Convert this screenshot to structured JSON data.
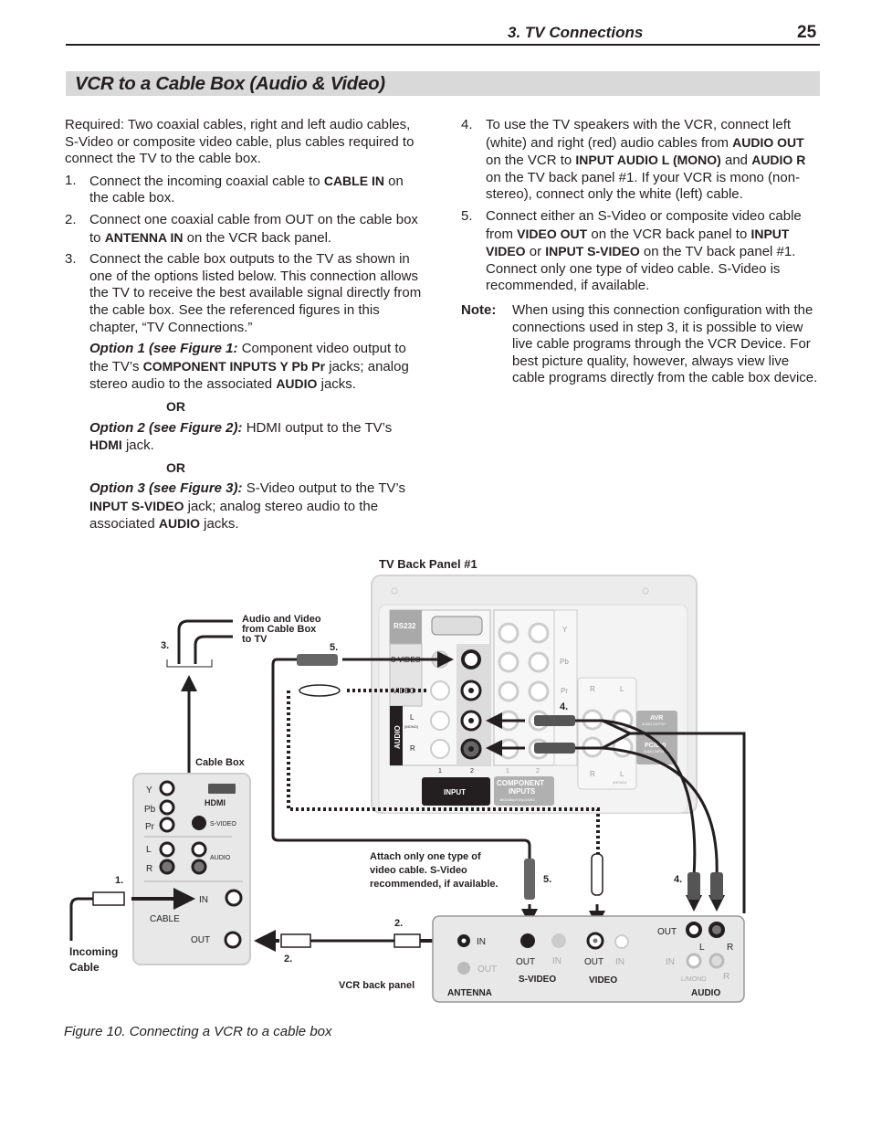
{
  "header": {
    "section": "3. TV Connections",
    "page_number": "25"
  },
  "title": "VCR to a Cable Box (Audio & Video)",
  "left": {
    "required": "Required:  Two coaxial cables, right and left audio cables, S-Video or composite video cable, plus cables required to connect the TV to the cable box.",
    "steps": [
      {
        "n": "1.",
        "a": "Connect the incoming coaxial cable to ",
        "b": "CABLE IN",
        "c": " on the cable box."
      },
      {
        "n": "2.",
        "a": "Connect one coaxial cable from OUT on the cable box to ",
        "b": "ANTENNA IN",
        "c": " on the VCR back panel."
      },
      {
        "n": "3.",
        "a": "Connect the cable box outputs to the TV as shown in one of the options listed below.  This connection allows the TV to receive the best available signal directly from the cable box.  See the referenced figures in this chapter, “TV Connections.”"
      }
    ],
    "option1": {
      "label": "Option 1 (see Figure 1:",
      "a": " Component video output to the TV’s ",
      "b": "COMPONENT INPUTS  Y Pb Pr",
      "c": " jacks; analog stereo audio to the associated ",
      "d": "AUDIO",
      "e": " jacks."
    },
    "or": "OR",
    "option2": {
      "label": "Option 2 (see Figure 2):",
      "a": " HDMI output to the TV’s ",
      "b": "HDMI",
      "c": " jack."
    },
    "option3": {
      "label": "Option 3 (see Figure 3):",
      "a": " S-Video output to the TV’s ",
      "b": "INPUT S-VIDEO",
      "c": " jack; analog stereo audio to the associated ",
      "d": "AUDIO",
      "e": " jacks."
    }
  },
  "right": {
    "step4": {
      "n": "4.",
      "a": "To use the TV speakers with the VCR, connect left (white) and right (red) audio cables from ",
      "b": "AUDIO OUT",
      "c": " on the VCR to ",
      "d": "INPUT AUDIO L (MONO)",
      "e": " and ",
      "f": "AUDIO R",
      "g": " on the TV back panel #1.  If your VCR is mono (non-stereo), connect only the white (left) cable."
    },
    "step5": {
      "n": "5.",
      "a": "Connect either an S-Video or composite video cable from ",
      "b": "VIDEO OUT",
      "c": " on the VCR back panel to ",
      "d": "INPUT VIDEO",
      "e": " or ",
      "f": "INPUT S-VIDEO",
      "g": " on the TV back panel #1.  Connect only one type of video cable.  S-Video is recommended, if available."
    },
    "note": {
      "label": "Note:",
      "text": "When using this connection configuration with the connections used in step 3, it is possible to view live cable programs through the VCR Device.  For best picture quality, however,  always view live cable programs directly from the cable box device."
    }
  },
  "figure": {
    "tv_panel_label": "TV Back Panel #1",
    "tv": {
      "rs232": "RS232",
      "svideo": "S-VIDEO",
      "video": "VIDEO",
      "audio": "AUDIO",
      "l": "L",
      "mono": "(MONO)",
      "r": "R",
      "one": "1",
      "two": "2",
      "input": "INPUT",
      "component": "COMPONENT",
      "inputs": "INPUTS",
      "resolutions": "480i/480p/720p/1080i",
      "y": "Y",
      "pb": "Pb",
      "pr": "Pr",
      "avr": "AVR",
      "avr_sub": "AUDIO OUTPUT",
      "pcdvi": "PC/DVI",
      "pcdvi_sub": "AUDIO INPUT"
    },
    "av_label": [
      "Audio and Video",
      "from Cable Box",
      "to TV"
    ],
    "cable_box_label": "Cable Box",
    "cable_box": {
      "y": "Y",
      "pb": "Pb",
      "pr": "Pr",
      "hdmi": "HDMI",
      "svideo": "S-VIDEO",
      "l": "L",
      "r": "R",
      "audio": "AUDIO",
      "in": "IN",
      "cable": "CABLE",
      "out": "OUT"
    },
    "incoming_cable": [
      "Incoming",
      "Cable"
    ],
    "steps": {
      "s1": "1.",
      "s2": "2.",
      "s3": "3.",
      "s4": "4.",
      "s5": "5."
    },
    "attach_note": [
      "Attach only one type of",
      "video cable.  S-Video",
      "recommended, if available."
    ],
    "vcr_panel_label": "VCR back panel",
    "vcr": {
      "in": "IN",
      "out": "OUT",
      "antenna": "ANTENNA",
      "svideo": "S-VIDEO",
      "video": "VIDEO",
      "audio": "AUDIO",
      "l": "L",
      "r": "R",
      "lmono": "L/MONO"
    },
    "caption": "Figure 10.  Connecting a VCR to a cable box"
  }
}
